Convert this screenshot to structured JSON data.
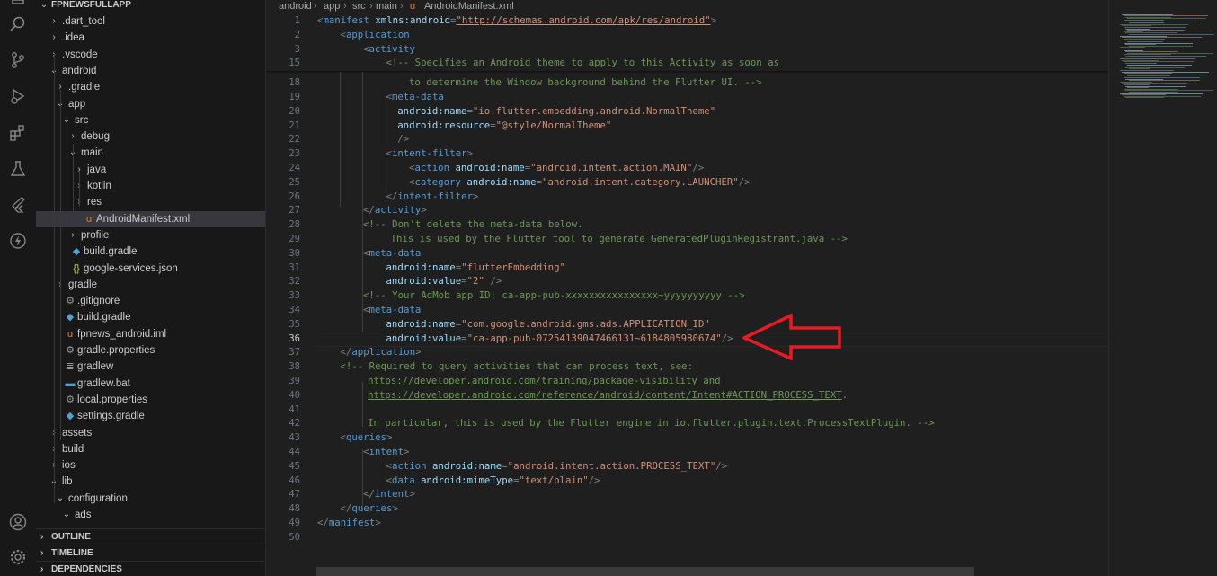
{
  "activity_bar": {
    "icons": [
      "files-icon",
      "search-icon",
      "source-control-icon",
      "run-debug-icon",
      "extensions-icon",
      "testing-icon",
      "flutter-icon",
      "lightning-icon",
      "account-icon",
      "settings-gear-icon"
    ]
  },
  "explorer": {
    "root": "FPNEWSFULLAPP",
    "items": [
      {
        "label": ".dart_tool",
        "depth": 1,
        "chevron": "›",
        "icon": ""
      },
      {
        "label": ".idea",
        "depth": 1,
        "chevron": "›",
        "icon": ""
      },
      {
        "label": ".vscode",
        "depth": 1,
        "chevron": "›",
        "icon": ""
      },
      {
        "label": "android",
        "depth": 1,
        "chevron": "⌄",
        "icon": ""
      },
      {
        "label": ".gradle",
        "depth": 2,
        "chevron": "›",
        "icon": ""
      },
      {
        "label": "app",
        "depth": 2,
        "chevron": "⌄",
        "icon": ""
      },
      {
        "label": "src",
        "depth": 3,
        "chevron": "⌄",
        "icon": ""
      },
      {
        "label": "debug",
        "depth": 4,
        "chevron": "›",
        "icon": ""
      },
      {
        "label": "main",
        "depth": 4,
        "chevron": "⌄",
        "icon": ""
      },
      {
        "label": "java",
        "depth": 5,
        "chevron": "›",
        "icon": ""
      },
      {
        "label": "kotlin",
        "depth": 5,
        "chevron": "›",
        "icon": ""
      },
      {
        "label": "res",
        "depth": 5,
        "chevron": "›",
        "icon": ""
      },
      {
        "label": "AndroidManifest.xml",
        "depth": 5,
        "chevron": "",
        "icon": "rss",
        "selected": true
      },
      {
        "label": "profile",
        "depth": 4,
        "chevron": "›",
        "icon": ""
      },
      {
        "label": "build.gradle",
        "depth": 3,
        "chevron": "",
        "icon": "elephant"
      },
      {
        "label": "google-services.json",
        "depth": 3,
        "chevron": "",
        "icon": "braces"
      },
      {
        "label": "gradle",
        "depth": 2,
        "chevron": "›",
        "icon": ""
      },
      {
        "label": ".gitignore",
        "depth": 2,
        "chevron": "",
        "icon": "gear"
      },
      {
        "label": "build.gradle",
        "depth": 2,
        "chevron": "",
        "icon": "elephant"
      },
      {
        "label": "fpnews_android.iml",
        "depth": 2,
        "chevron": "",
        "icon": "rss"
      },
      {
        "label": "gradle.properties",
        "depth": 2,
        "chevron": "",
        "icon": "gear"
      },
      {
        "label": "gradlew",
        "depth": 2,
        "chevron": "",
        "icon": "lines"
      },
      {
        "label": "gradlew.bat",
        "depth": 2,
        "chevron": "",
        "icon": "bat"
      },
      {
        "label": "local.properties",
        "depth": 2,
        "chevron": "",
        "icon": "gear"
      },
      {
        "label": "settings.gradle",
        "depth": 2,
        "chevron": "",
        "icon": "elephant"
      },
      {
        "label": "assets",
        "depth": 1,
        "chevron": "›",
        "icon": ""
      },
      {
        "label": "build",
        "depth": 1,
        "chevron": "›",
        "icon": ""
      },
      {
        "label": "ios",
        "depth": 1,
        "chevron": "›",
        "icon": ""
      },
      {
        "label": "lib",
        "depth": 1,
        "chevron": "⌄",
        "icon": ""
      },
      {
        "label": "configuration",
        "depth": 2,
        "chevron": "⌄",
        "icon": ""
      },
      {
        "label": "ads",
        "depth": 3,
        "chevron": "⌄",
        "icon": ""
      }
    ],
    "sections": [
      "OUTLINE",
      "TIMELINE",
      "DEPENDENCIES"
    ]
  },
  "breadcrumb": [
    "android",
    "app",
    "src",
    "main",
    "AndroidManifest.xml"
  ],
  "editor": {
    "current_line": "36",
    "lines": [
      {
        "n": "1",
        "indent": 0,
        "tokens": [
          [
            "punc",
            "<"
          ],
          [
            "tag",
            "manifest"
          ],
          [
            "plain",
            " "
          ],
          [
            "attr",
            "xmlns:android"
          ],
          [
            "punc",
            "="
          ],
          [
            "strlink",
            "\"http://schemas.android.com/apk/res/android\""
          ],
          [
            "punc",
            ">"
          ]
        ]
      },
      {
        "n": "2",
        "indent": 1,
        "tokens": [
          [
            "punc",
            "<"
          ],
          [
            "tag",
            "application"
          ]
        ]
      },
      {
        "n": "3",
        "indent": 2,
        "tokens": [
          [
            "punc",
            "<"
          ],
          [
            "tag",
            "activity"
          ]
        ]
      },
      {
        "n": "15",
        "indent": 3,
        "tokens": [
          [
            "cmt",
            "<!-- Specifies an Android theme to apply to this Activity as soon as"
          ]
        ]
      },
      {
        "n": "18",
        "indent": 4,
        "tokens": [
          [
            "cmt",
            "to determine the Window background behind the Flutter UI. -->"
          ]
        ]
      },
      {
        "n": "19",
        "indent": 3,
        "tokens": [
          [
            "punc",
            "<"
          ],
          [
            "tag",
            "meta-data"
          ]
        ]
      },
      {
        "n": "20",
        "indent": 3.5,
        "tokens": [
          [
            "attr",
            "android:name"
          ],
          [
            "punc",
            "="
          ],
          [
            "str",
            "\"io.flutter.embedding.android.NormalTheme\""
          ]
        ]
      },
      {
        "n": "21",
        "indent": 3.5,
        "tokens": [
          [
            "attr",
            "android:resource"
          ],
          [
            "punc",
            "="
          ],
          [
            "str",
            "\"@style/NormalTheme\""
          ]
        ]
      },
      {
        "n": "22",
        "indent": 3.5,
        "tokens": [
          [
            "punc",
            "/>"
          ]
        ]
      },
      {
        "n": "23",
        "indent": 3,
        "tokens": [
          [
            "punc",
            "<"
          ],
          [
            "tag",
            "intent-filter"
          ],
          [
            "punc",
            ">"
          ]
        ]
      },
      {
        "n": "24",
        "indent": 4,
        "tokens": [
          [
            "punc",
            "<"
          ],
          [
            "tag",
            "action"
          ],
          [
            "plain",
            " "
          ],
          [
            "attr",
            "android:name"
          ],
          [
            "punc",
            "="
          ],
          [
            "str",
            "\"android.intent.action.MAIN\""
          ],
          [
            "punc",
            "/>"
          ]
        ]
      },
      {
        "n": "25",
        "indent": 4,
        "tokens": [
          [
            "punc",
            "<"
          ],
          [
            "tag",
            "category"
          ],
          [
            "plain",
            " "
          ],
          [
            "attr",
            "android:name"
          ],
          [
            "punc",
            "="
          ],
          [
            "str",
            "\"android.intent.category.LAUNCHER\""
          ],
          [
            "punc",
            "/>"
          ]
        ]
      },
      {
        "n": "26",
        "indent": 3,
        "tokens": [
          [
            "punc",
            "</"
          ],
          [
            "tag",
            "intent-filter"
          ],
          [
            "punc",
            ">"
          ]
        ]
      },
      {
        "n": "27",
        "indent": 2,
        "tokens": [
          [
            "punc",
            "</"
          ],
          [
            "tag",
            "activity"
          ],
          [
            "punc",
            ">"
          ]
        ]
      },
      {
        "n": "28",
        "indent": 2,
        "tokens": [
          [
            "cmt",
            "<!-- Don't delete the meta-data below."
          ]
        ]
      },
      {
        "n": "29",
        "indent": 3.2,
        "tokens": [
          [
            "cmt",
            "This is used by the Flutter tool to generate GeneratedPluginRegistrant.java -->"
          ]
        ]
      },
      {
        "n": "30",
        "indent": 2,
        "tokens": [
          [
            "punc",
            "<"
          ],
          [
            "tag",
            "meta-data"
          ]
        ]
      },
      {
        "n": "31",
        "indent": 3,
        "tokens": [
          [
            "attr",
            "android:name"
          ],
          [
            "punc",
            "="
          ],
          [
            "str",
            "\"flutterEmbedding\""
          ]
        ]
      },
      {
        "n": "32",
        "indent": 3,
        "tokens": [
          [
            "attr",
            "android:value"
          ],
          [
            "punc",
            "="
          ],
          [
            "str",
            "\"2\""
          ],
          [
            "plain",
            " "
          ],
          [
            "punc",
            "/>"
          ]
        ]
      },
      {
        "n": "33",
        "indent": 2,
        "tokens": [
          [
            "cmt",
            "<!-- Your AdMob app ID: ca-app-pub-xxxxxxxxxxxxxxxx~yyyyyyyyyy -->"
          ]
        ]
      },
      {
        "n": "34",
        "indent": 2,
        "tokens": [
          [
            "punc",
            "<"
          ],
          [
            "tag",
            "meta-data"
          ]
        ]
      },
      {
        "n": "35",
        "indent": 3,
        "tokens": [
          [
            "attr",
            "android:name"
          ],
          [
            "punc",
            "="
          ],
          [
            "str",
            "\"com.google.android.gms.ads.APPLICATION_ID\""
          ]
        ]
      },
      {
        "n": "36",
        "indent": 3,
        "tokens": [
          [
            "attr",
            "android:value"
          ],
          [
            "punc",
            "="
          ],
          [
            "str",
            "\"ca-app-pub-0725413904​7466131~6184805980674\""
          ],
          [
            "punc",
            "/>"
          ]
        ]
      },
      {
        "n": "37",
        "indent": 1,
        "tokens": [
          [
            "punc",
            "</"
          ],
          [
            "tag",
            "application"
          ],
          [
            "punc",
            ">"
          ]
        ]
      },
      {
        "n": "38",
        "indent": 1,
        "tokens": [
          [
            "cmt",
            "<!-- Required to query activities that can process text, see:"
          ]
        ]
      },
      {
        "n": "39",
        "indent": 2.2,
        "tokens": [
          [
            "link",
            "https://developer.android.com/training/package-visibility"
          ],
          [
            "cmt",
            " and"
          ]
        ]
      },
      {
        "n": "40",
        "indent": 2.2,
        "tokens": [
          [
            "link",
            "https://developer.android.com/reference/android/content/Intent#ACTION_PROCESS_TEXT"
          ],
          [
            "cmt",
            "."
          ]
        ]
      },
      {
        "n": "41",
        "indent": 0,
        "tokens": []
      },
      {
        "n": "42",
        "indent": 2.2,
        "tokens": [
          [
            "cmt",
            "In particular, this is used by the Flutter engine in io.flutter.plugin.text.ProcessTextPlugin. -->"
          ]
        ]
      },
      {
        "n": "43",
        "indent": 1,
        "tokens": [
          [
            "punc",
            "<"
          ],
          [
            "tag",
            "queries"
          ],
          [
            "punc",
            ">"
          ]
        ]
      },
      {
        "n": "44",
        "indent": 2,
        "tokens": [
          [
            "punc",
            "<"
          ],
          [
            "tag",
            "intent"
          ],
          [
            "punc",
            ">"
          ]
        ]
      },
      {
        "n": "45",
        "indent": 3,
        "tokens": [
          [
            "punc",
            "<"
          ],
          [
            "tag",
            "action"
          ],
          [
            "plain",
            " "
          ],
          [
            "attr",
            "android:name"
          ],
          [
            "punc",
            "="
          ],
          [
            "str",
            "\"android.intent.action.PROCESS_TEXT\""
          ],
          [
            "punc",
            "/>"
          ]
        ]
      },
      {
        "n": "46",
        "indent": 3,
        "tokens": [
          [
            "punc",
            "<"
          ],
          [
            "tag",
            "data"
          ],
          [
            "plain",
            " "
          ],
          [
            "attr",
            "android:mimeType"
          ],
          [
            "punc",
            "="
          ],
          [
            "str",
            "\"text/plain\""
          ],
          [
            "punc",
            "/>"
          ]
        ]
      },
      {
        "n": "47",
        "indent": 2,
        "tokens": [
          [
            "punc",
            "</"
          ],
          [
            "tag",
            "intent"
          ],
          [
            "punc",
            ">"
          ]
        ]
      },
      {
        "n": "48",
        "indent": 1,
        "tokens": [
          [
            "punc",
            "</"
          ],
          [
            "tag",
            "queries"
          ],
          [
            "punc",
            ">"
          ]
        ]
      },
      {
        "n": "49",
        "indent": 0,
        "tokens": [
          [
            "punc",
            "</"
          ],
          [
            "tag",
            "manifest"
          ],
          [
            "punc",
            ">"
          ]
        ]
      },
      {
        "n": "50",
        "indent": 0,
        "tokens": []
      }
    ]
  },
  "colors": {
    "tag": "#569cd6",
    "attr": "#9cdcfe",
    "string": "#ce9178",
    "comment": "#6a9955",
    "arrow": "#e51c23"
  }
}
